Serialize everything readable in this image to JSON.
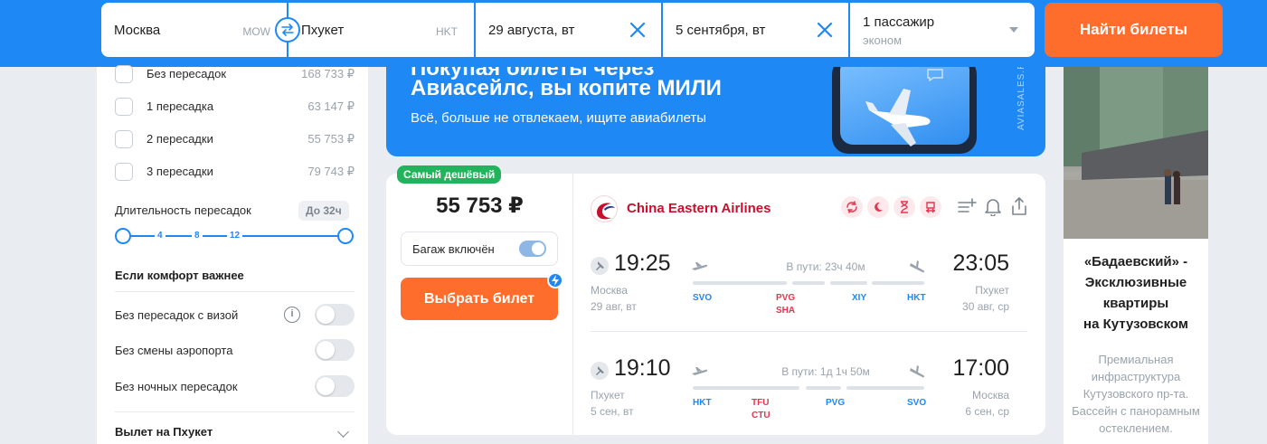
{
  "search": {
    "from_city": "Москва",
    "from_code": "MOW",
    "to_city": "Пхукет",
    "to_code": "HKT",
    "date_depart": "29 августа, вт",
    "date_return": "5 сентября, вт",
    "passengers": "1 пассажир",
    "cabin_class": "эконом",
    "find_button": "Найти билеты"
  },
  "filters": {
    "stops": [
      {
        "label": "Без пересадок",
        "price": "168 733 ₽"
      },
      {
        "label": "1 пересадка",
        "price": "63 147 ₽"
      },
      {
        "label": "2 пересадки",
        "price": "55 753 ₽"
      },
      {
        "label": "3 пересадки",
        "price": "79 743 ₽"
      }
    ],
    "duration_title": "Длительность пересадок",
    "duration_badge": "До 32ч",
    "duration_ticks": [
      "4",
      "8",
      "12"
    ],
    "comfort_title": "Если комфорт важнее",
    "comfort_options": [
      {
        "label": "Без пересадок с визой"
      },
      {
        "label": "Без смены аэропорта"
      },
      {
        "label": "Без ночных пересадок"
      }
    ],
    "info_glyph": "i",
    "departure_title": "Вылет на Пхукет"
  },
  "banner": {
    "line1": "Покупая билеты через",
    "line2": "Авиасейлс, вы копите МИЛИ",
    "line3": "Всё, больше не отвлекаем, ищите авиабилеты",
    "vertical": "AVIASALES.RU"
  },
  "ticket": {
    "badge": "Самый дешёвый",
    "price": "55 753 ₽",
    "baggage_label": "Багаж включён",
    "select_button": "Выбрать билет",
    "airline": "China Eastern Airlines",
    "segments": [
      {
        "dep_time": "19:25",
        "arr_time": "23:05",
        "duration": "В пути: 23ч 40м",
        "dep_city": "Москва",
        "dep_date": "29 авг, вт",
        "arr_city": "Пхукет",
        "arr_date": "30 авг, ср",
        "airports": {
          "start": "SVO",
          "stop1": "PVG",
          "stop1b": "SHA",
          "stop2": "XIY",
          "end": "HKT"
        }
      },
      {
        "dep_time": "19:10",
        "arr_time": "17:00",
        "duration": "В пути: 1д 1ч 50м",
        "dep_city": "Пхукет",
        "dep_date": "5 сен, вт",
        "arr_city": "Москва",
        "arr_date": "6 сен, ср",
        "airports": {
          "start": "HKT",
          "stop1": "TFU",
          "stop1b": "CTU",
          "stop2": "PVG",
          "end": "SVO"
        }
      }
    ]
  },
  "ad": {
    "title_lines": [
      "«Бадаевский» -",
      "Эксклюзивные",
      "квартиры",
      "на Кутузовском"
    ],
    "text_lines": [
      "Премиальная",
      "инфраструктура",
      "Кутузовского пр-та.",
      "Бассейн с панорамным",
      "остеклением."
    ]
  },
  "colors": {
    "brand_blue": "#1e88f5",
    "cta_orange": "#ff6d2d",
    "cheap_green": "#22b45c",
    "airline_red": "#c8102e"
  }
}
